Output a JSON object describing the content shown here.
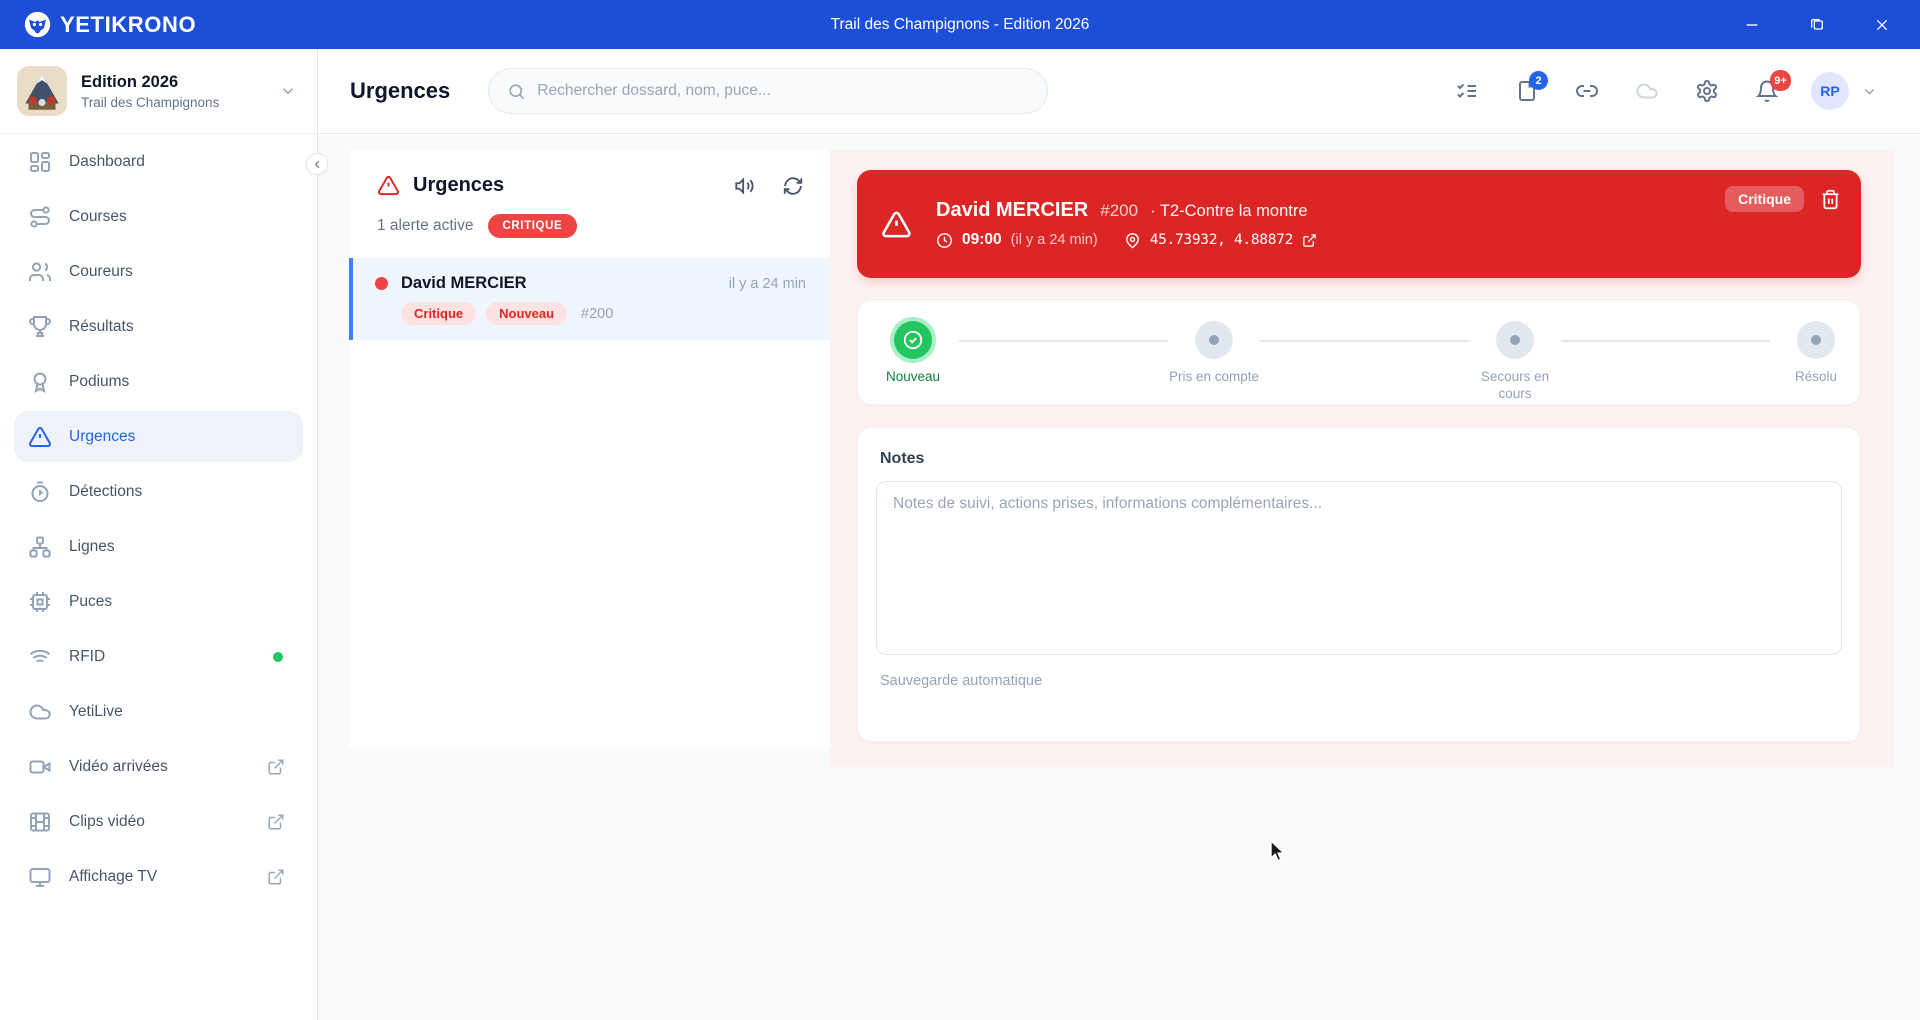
{
  "titlebar": {
    "app_name": "YETIKRONO",
    "window_title": "Trail des Champignons - Edition 2026"
  },
  "sidebar": {
    "edition": {
      "title": "Edition 2026",
      "subtitle": "Trail des Champignons"
    },
    "items": [
      {
        "label": "Dashboard"
      },
      {
        "label": "Courses"
      },
      {
        "label": "Coureurs"
      },
      {
        "label": "Résultats"
      },
      {
        "label": "Podiums"
      },
      {
        "label": "Urgences",
        "active": true
      },
      {
        "label": "Détections"
      },
      {
        "label": "Lignes"
      },
      {
        "label": "Puces"
      },
      {
        "label": "RFID",
        "status_dot": "online"
      },
      {
        "label": "YetiLive"
      },
      {
        "label": "Vidéo arrivées",
        "external": true
      },
      {
        "label": "Clips vidéo",
        "external": true
      },
      {
        "label": "Affichage TV",
        "external": true
      }
    ]
  },
  "header": {
    "page_title": "Urgences",
    "search_placeholder": "Rechercher dossard, nom, puce...",
    "documents_badge": "2",
    "notifications_badge": "9+",
    "avatar_initials": "RP"
  },
  "alerts_panel": {
    "title": "Urgences",
    "active_count_label": "1 alerte active",
    "severity_badge": "CRITIQUE",
    "alert": {
      "name": "David MERCIER",
      "time_ago": "il y a 24 min",
      "tag_severity": "Critique",
      "tag_status": "Nouveau",
      "bib": "#200"
    }
  },
  "detail": {
    "card": {
      "name": "David MERCIER",
      "bib": "#200",
      "race": "· T2-Contre la montre",
      "time": "09:00",
      "time_ago": "(il y a 24 min)",
      "coords": "45.73932, 4.88872",
      "severity": "Critique"
    },
    "stepper": {
      "steps": [
        {
          "label": "Nouveau",
          "state": "done"
        },
        {
          "label": "Pris en compte",
          "state": "todo"
        },
        {
          "label": "Secours en cours",
          "state": "todo"
        },
        {
          "label": "Résolu",
          "state": "todo"
        }
      ]
    },
    "notes": {
      "title": "Notes",
      "placeholder": "Notes de suivi, actions prises, informations complémentaires...",
      "autosave": "Sauvegarde automatique"
    }
  },
  "colors": {
    "titlebar_blue": "#1D4ED8",
    "accent_blue": "#2563EB",
    "critical_red": "#DC2626",
    "badge_red": "#EF4444",
    "success_green": "#22C55E",
    "pane_pink": "#FDF2F2",
    "selected_blue": "#EFF6FF"
  }
}
